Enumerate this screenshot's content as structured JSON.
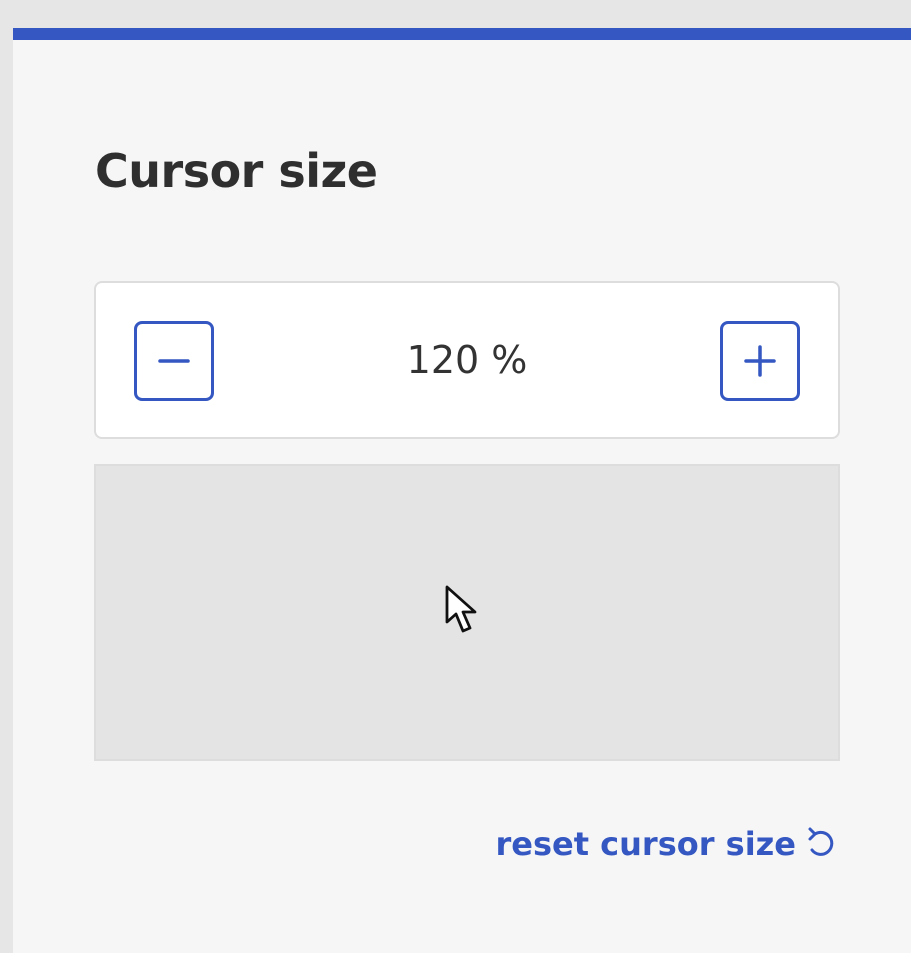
{
  "panel": {
    "title": "Cursor size",
    "accent_color": "#3457c2"
  },
  "stepper": {
    "decrease_icon": "minus-icon",
    "increase_icon": "plus-icon",
    "value_text": "120 %",
    "value_percent": 120
  },
  "preview": {
    "icon": "mouse-pointer-icon"
  },
  "reset": {
    "label": "reset cursor size",
    "icon": "reset-arrow-icon"
  }
}
